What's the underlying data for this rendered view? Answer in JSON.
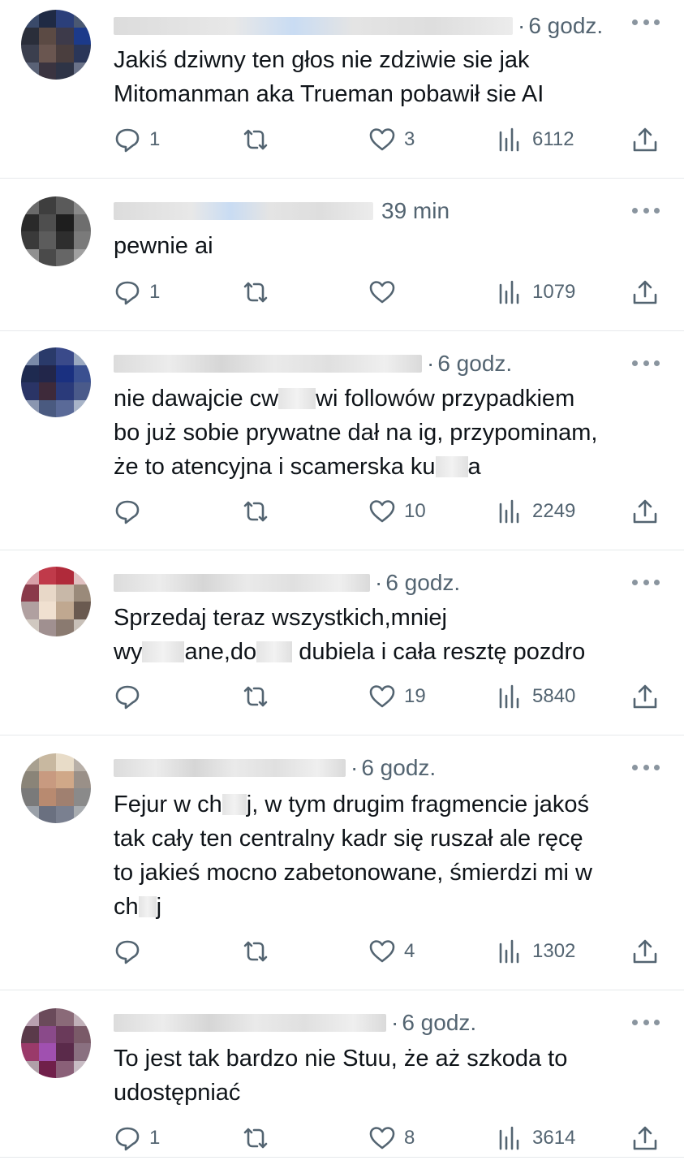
{
  "replies": [
    {
      "time": "6 godz.",
      "lines": [
        "Jakiś dziwny ten głos nie zdziwie sie jak",
        "Mitomanman aka Trueman pobawił sie AI"
      ],
      "reply_count": "1",
      "like_count": "3",
      "view_count": "6112"
    },
    {
      "time": "39 min",
      "lines": [
        "pewnie ai"
      ],
      "reply_count": "1",
      "like_count": "",
      "view_count": "1079"
    },
    {
      "time": "6 godz.",
      "lines": [
        "nie dawajcie cw",
        "wi followów przypadkiem",
        "bo już sobie prywatne dał na ig, przypominam,",
        "że to atencyjna i scamerska ku",
        "a"
      ],
      "reply_count": "",
      "like_count": "10",
      "view_count": "2249"
    },
    {
      "time": "6 godz.",
      "lines": [
        "Sprzedaj teraz wszystkich,mniej",
        "wy",
        "ane,do",
        "dubiela i cała resztę pozdro"
      ],
      "reply_count": "",
      "like_count": "19",
      "view_count": "5840"
    },
    {
      "time": "6 godz.",
      "lines": [
        "Fejur w ch",
        "j, w tym drugim fragmencie jakoś",
        "tak cały ten centralny kadr się ruszał ale ręcę",
        "to jakieś mocno zabetonowane, śmierdzi mi w",
        "ch",
        "j"
      ],
      "reply_count": "",
      "like_count": "4",
      "view_count": "1302"
    },
    {
      "time": "6 godz.",
      "lines": [
        "To jest tak bardzo nie Stuu, że aż szkoda to",
        "udostępniać"
      ],
      "reply_count": "1",
      "like_count": "8",
      "view_count": "3614"
    }
  ],
  "separator": "·",
  "icons": {
    "reply": "reply-bubble-icon",
    "retweet": "retweet-icon",
    "like": "heart-icon",
    "views": "views-chart-icon",
    "share": "share-upload-icon",
    "more": "more-dots-icon"
  },
  "colors": {
    "text": "#0f1419",
    "muted": "#536471",
    "divider": "#e6e9eb"
  }
}
